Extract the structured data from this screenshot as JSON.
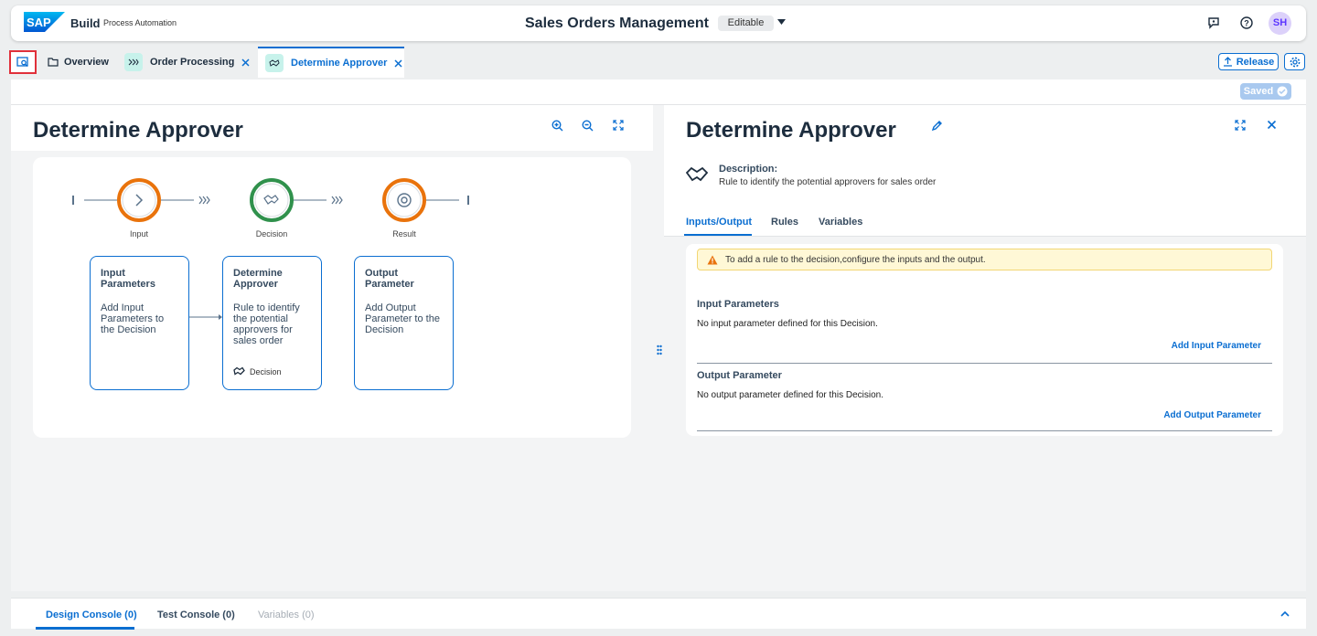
{
  "shell": {
    "brand": "Build",
    "product": "Process Automation",
    "title": "Sales Orders Management",
    "status": "Editable",
    "avatar_initials": "SH",
    "icons": [
      "sap-logo-icon",
      "feedback-icon",
      "help-icon"
    ]
  },
  "tabs": [
    {
      "label": "Overview",
      "icon": "folder-icon",
      "closable": false
    },
    {
      "label": "Order Processing",
      "icon": "process-icon",
      "closable": true
    },
    {
      "label": "Determine Approver",
      "icon": "decision-icon",
      "closable": true,
      "active": true
    }
  ],
  "toolbar": {
    "release_label": "Release",
    "saved_label": "Saved"
  },
  "canvas": {
    "title": "Determine Approver",
    "nodes": [
      {
        "label": "Input",
        "color": "#e9730c"
      },
      {
        "label": "Decision",
        "color": "#30914c"
      },
      {
        "label": "Result",
        "color": "#e9730c"
      }
    ],
    "boxes": [
      {
        "title": "Input Parameters",
        "desc": "Add Input Parameters to the Decision",
        "footer": ""
      },
      {
        "title": "Determine Approver",
        "desc": "Rule to identify the potential approvers for sales order",
        "footer": "Decision"
      },
      {
        "title": "Output Parameter",
        "desc": "Add Output Parameter to the Decision",
        "footer": ""
      }
    ]
  },
  "detail": {
    "title": "Determine Approver",
    "description_label": "Description:",
    "description": "Rule to identify the potential approvers for sales order",
    "tabs": [
      "Inputs/Output",
      "Rules",
      "Variables"
    ],
    "warning": "To add a rule to the decision,configure the inputs and the output.",
    "input_title": "Input Parameters",
    "input_empty": "No input parameter defined for this Decision.",
    "input_link": "Add Input Parameter",
    "output_title": "Output Parameter",
    "output_empty": "No output parameter defined for this Decision.",
    "output_link": "Add Output Parameter"
  },
  "console": {
    "tabs": [
      "Design Console (0)",
      "Test Console (0)",
      "Variables (0)"
    ]
  },
  "colors": {
    "accent": "#0a6ed1",
    "warning": "#e9730c",
    "success": "#30914c"
  }
}
